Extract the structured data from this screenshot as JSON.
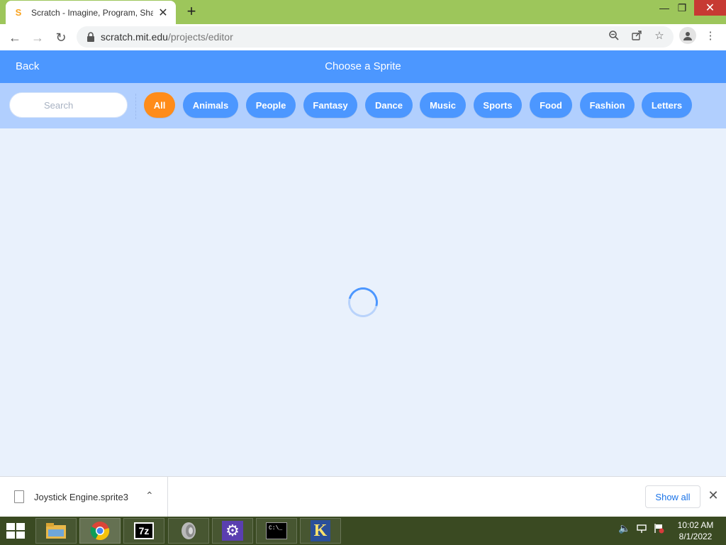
{
  "browser": {
    "tab_title": "Scratch - Imagine, Program, Share",
    "favicon": "S",
    "url_domain": "scratch.mit.edu",
    "url_path": "/projects/editor"
  },
  "modal": {
    "back_label": "Back",
    "title": "Choose a Sprite",
    "search_placeholder": "Search",
    "tags": [
      "All",
      "Animals",
      "People",
      "Fantasy",
      "Dance",
      "Music",
      "Sports",
      "Food",
      "Fashion",
      "Letters"
    ],
    "active_tag": "All"
  },
  "downloads": {
    "file_name": "Joystick Engine.sprite3",
    "show_all_label": "Show all"
  },
  "taskbar": {
    "apps": [
      "file-explorer",
      "chrome",
      "7-zip",
      "speaker",
      "settings",
      "command-prompt",
      "k-app"
    ],
    "time": "10:02 AM",
    "date": "8/1/2022"
  },
  "colors": {
    "scratch_blue": "#4c97ff",
    "active_orange": "#ff8c1a",
    "filter_bar": "#b1cffe",
    "library_bg": "#e9f1fc",
    "tabstrip": "#9dc65b"
  }
}
